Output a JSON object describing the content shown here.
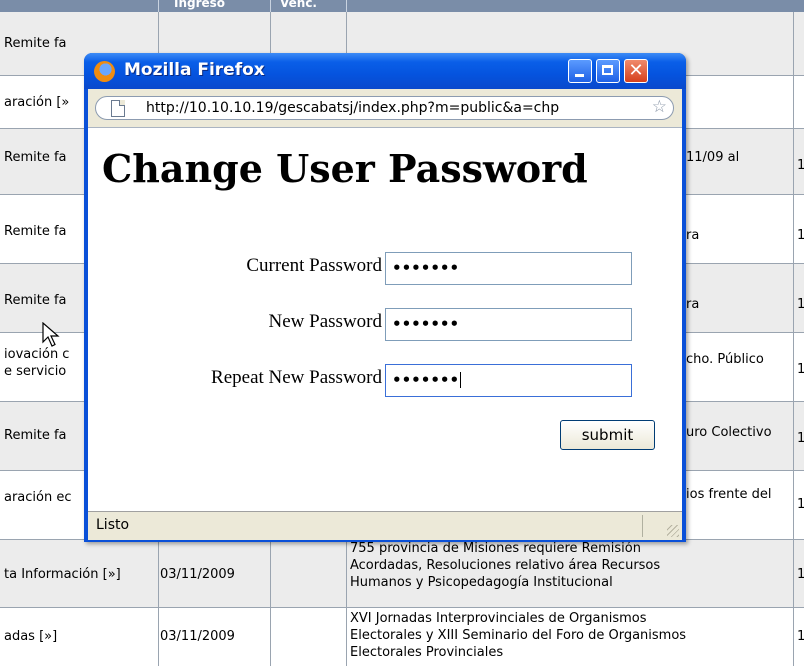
{
  "background": {
    "header": {
      "col_ingreso": "Ingreso",
      "col_venc": "Venc."
    },
    "rows": [
      {
        "c1": "Remite fa",
        "c4": ""
      },
      {
        "c1": "aración [»",
        "c4": ""
      },
      {
        "c1": "Remite fa",
        "c4": "11/09 al",
        "c5": "1"
      },
      {
        "c1": "Remite fa",
        "c4": "ra",
        "c5": "1"
      },
      {
        "c1": "Remite fa",
        "c4": "ra",
        "c5": "1"
      },
      {
        "c1a": "iovación c",
        "c1b": "e servicio",
        "c4": "cho. Público",
        "c5": "1"
      },
      {
        "c1": "Remite fa",
        "c4": "uro Colectivo",
        "c5": "1"
      },
      {
        "c1": "aración ec",
        "c4": "ios frente del",
        "c5": "1"
      },
      {
        "c1": "ta Información [»]",
        "c2": "03/11/2009",
        "c4a": "755 provincia de Misiones requiere Remisión",
        "c4b": "Acordadas, Resoluciones relativo área Recursos",
        "c4c": "Humanos y Psicopedagogía Institucional",
        "c5": "1"
      },
      {
        "c1": "adas [»]",
        "c2": "03/11/2009",
        "c4a": "XVI Jornadas Interprovinciales de Organismos",
        "c4b": "Electorales y XIII Seminario del Foro de Organismos",
        "c4c": "Electorales Provinciales",
        "c5": "1"
      }
    ]
  },
  "window": {
    "title": "Mozilla Firefox",
    "url": "http://10.10.10.19/gescabatsj/index.php?m=public&a=chp",
    "status": "Listo"
  },
  "form": {
    "heading": "Change User Password",
    "fields": [
      {
        "label": "Current Password",
        "value": "•••••••"
      },
      {
        "label": "New Password",
        "value": "•••••••"
      },
      {
        "label": "Repeat New Password",
        "value": "•••••••"
      }
    ],
    "submit_label": "submit"
  },
  "colors": {
    "titlebar": "#0553de",
    "close_button": "#d6401c",
    "table_header": "#7a8da8",
    "chrome": "#ece9d8"
  },
  "icons": {
    "logo": "firefox-logo-icon",
    "page": "page-icon",
    "bookmark": "star-icon",
    "cursor": "mouse-pointer-icon"
  }
}
